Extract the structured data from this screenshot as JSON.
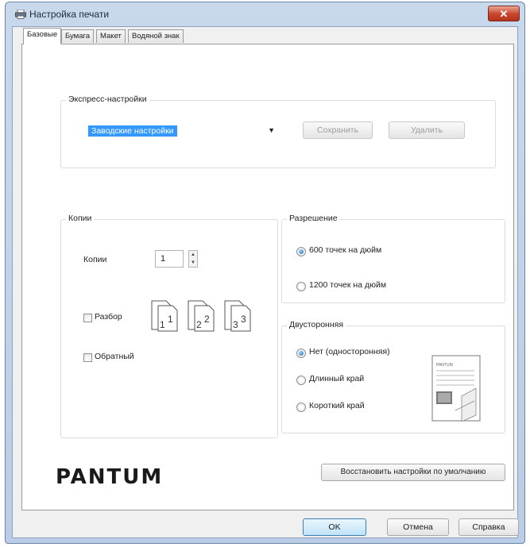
{
  "window": {
    "title": "Настройка печати",
    "close_label": "✕"
  },
  "tabs": [
    {
      "label": "Базовые",
      "active": true
    },
    {
      "label": "Бумага",
      "active": false
    },
    {
      "label": "Макет",
      "active": false
    },
    {
      "label": "Водяной знак",
      "active": false
    }
  ],
  "express": {
    "legend": "Экспресс-настройки",
    "selected": "Заводские настройки",
    "save_label": "Сохранить",
    "delete_label": "Удалить"
  },
  "copies": {
    "legend": "Копии",
    "count_label": "Копии",
    "count_value": "1",
    "collate_label": "Разбор",
    "reverse_label": "Обратный",
    "collate_pages": [
      "1",
      "1",
      "2",
      "2",
      "3",
      "3"
    ]
  },
  "resolution": {
    "legend": "Разрешение",
    "options": [
      {
        "label": "600 точек на дюйм",
        "selected": true
      },
      {
        "label": "1200 точек на дюйм",
        "selected": false
      }
    ]
  },
  "duplex": {
    "legend": "Двусторонняя",
    "options": [
      {
        "label": "Нет (односторонняя)",
        "selected": true
      },
      {
        "label": "Длинный край",
        "selected": false
      },
      {
        "label": "Короткий край",
        "selected": false
      }
    ],
    "preview_header": "PANTUM"
  },
  "brand": "PANTUM",
  "restore_label": "Восстановить настройки по умолчанию",
  "footer": {
    "ok_label": "OK",
    "cancel_label": "Отмена",
    "help_label": "Справка"
  }
}
